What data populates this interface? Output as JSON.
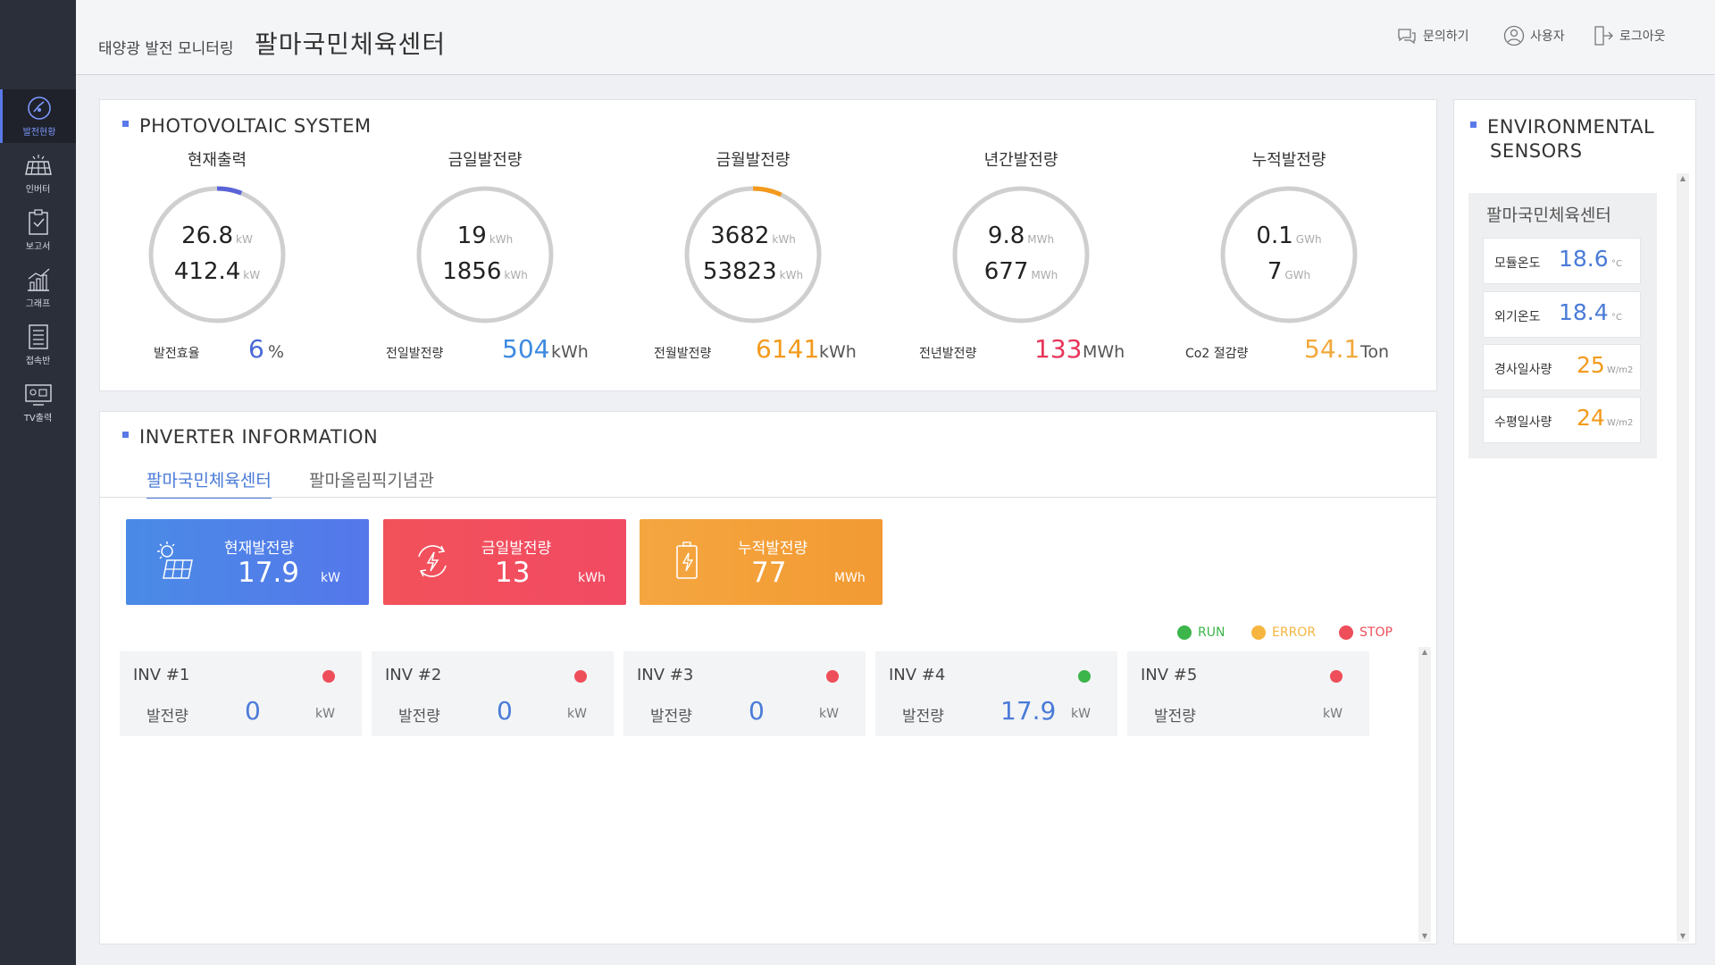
{
  "header": {
    "subtitle": "태양광 발전 모니터링",
    "title": "팔마국민체육센터",
    "menu": [
      {
        "label": "문의하기",
        "icon": "chat-icon"
      },
      {
        "label": "사용자",
        "icon": "user-icon"
      },
      {
        "label": "로그아웃",
        "icon": "logout-icon"
      }
    ]
  },
  "sidebar": {
    "items": [
      {
        "label": "발전현황",
        "icon": "dashboard-gauge-icon",
        "active": true
      },
      {
        "label": "인버터",
        "icon": "solar-panel-icon"
      },
      {
        "label": "보고서",
        "icon": "clipboard-icon"
      },
      {
        "label": "그래프",
        "icon": "chart-icon"
      },
      {
        "label": "접속반",
        "icon": "junction-box-icon"
      },
      {
        "label": "TV출력",
        "icon": "tv-icon"
      }
    ]
  },
  "pv": {
    "title": "PHOTOVOLTAIC SYSTEM",
    "gauges": [
      {
        "label": "현재출력",
        "v1": "26.8",
        "u1": "kW",
        "v2": "412.4",
        "u2": "kW",
        "foot_label": "발전효율",
        "foot_value": "6",
        "foot_unit": "%",
        "foot_color": "#4a68d8",
        "progress": 0.06,
        "arc_color": "#5a63d8"
      },
      {
        "label": "금일발전량",
        "v1": "19",
        "u1": "kWh",
        "v2": "1856",
        "u2": "kWh",
        "foot_label": "전일발전량",
        "foot_value": "504",
        "foot_unit": "kWh",
        "foot_color": "#3d8ae0",
        "progress": 0,
        "arc_color": "#3d8ae0"
      },
      {
        "label": "금월발전량",
        "v1": "3682",
        "u1": "kWh",
        "v2": "53823",
        "u2": "kWh",
        "foot_label": "전월발전량",
        "foot_value": "6141",
        "foot_unit": "kWh",
        "foot_color": "#f39a1c",
        "progress": 0.07,
        "arc_color": "#f39a1c"
      },
      {
        "label": "년간발전량",
        "v1": "9.8",
        "u1": "MWh",
        "v2": "677",
        "u2": "MWh",
        "foot_label": "전년발전량",
        "foot_value": "133",
        "foot_unit": "MWh",
        "foot_color": "#e8355a",
        "progress": 0,
        "arc_color": "#e8355a"
      },
      {
        "label": "누적발전량",
        "v1": "0.1",
        "u1": "GWh",
        "v2": "7",
        "u2": "GWh",
        "foot_label": "Co2 절감량",
        "foot_value": "54.1",
        "foot_unit": "Ton",
        "foot_color": "#f2a93b",
        "progress": 0,
        "arc_color": "#f2a93b"
      }
    ]
  },
  "inverter": {
    "title": "INVERTER INFORMATION",
    "tabs": [
      {
        "label": "팔마국민체육센터",
        "active": true
      },
      {
        "label": "팔마올림픽기념관",
        "active": false
      }
    ],
    "stats": [
      {
        "label": "현재발전량",
        "value": "17.9",
        "unit": "kW",
        "icon": "sun-panel-icon"
      },
      {
        "label": "금일발전량",
        "value": "13",
        "unit": "kWh",
        "icon": "energy-cycle-icon"
      },
      {
        "label": "누적발전량",
        "value": "77",
        "unit": "MWh",
        "icon": "battery-icon"
      }
    ],
    "legend": [
      {
        "label": "RUN",
        "color": "#3cb54a"
      },
      {
        "label": "ERROR",
        "color": "#f5b53f"
      },
      {
        "label": "STOP",
        "color": "#ee4e5a"
      }
    ],
    "cards": [
      {
        "name": "INV #1",
        "label": "발전량",
        "value": "0",
        "unit": "kW",
        "status_color": "#ee4e5a"
      },
      {
        "name": "INV #2",
        "label": "발전량",
        "value": "0",
        "unit": "kW",
        "status_color": "#ee4e5a"
      },
      {
        "name": "INV #3",
        "label": "발전량",
        "value": "0",
        "unit": "kW",
        "status_color": "#ee4e5a"
      },
      {
        "name": "INV #4",
        "label": "발전량",
        "value": "17.9",
        "unit": "kW",
        "status_color": "#3cb54a"
      },
      {
        "name": "INV #5",
        "label": "발전량",
        "value": "",
        "unit": "kW",
        "status_color": "#ee4e5a"
      }
    ]
  },
  "env": {
    "title_line1": "ENVIRONMENTAL",
    "title_line2": "SENSORS",
    "site": "팔마국민체육센터",
    "rows": [
      {
        "label": "모듈온도",
        "value": "18.6",
        "unit": "°C",
        "color": "#4a7bd8"
      },
      {
        "label": "외기온도",
        "value": "18.4",
        "unit": "°C",
        "color": "#4a7bd8"
      },
      {
        "label": "경사일사량",
        "value": "25",
        "unit": "W/m2",
        "color": "#f39a1c"
      },
      {
        "label": "수평일사량",
        "value": "24",
        "unit": "W/m2",
        "color": "#f39a1c"
      }
    ]
  }
}
